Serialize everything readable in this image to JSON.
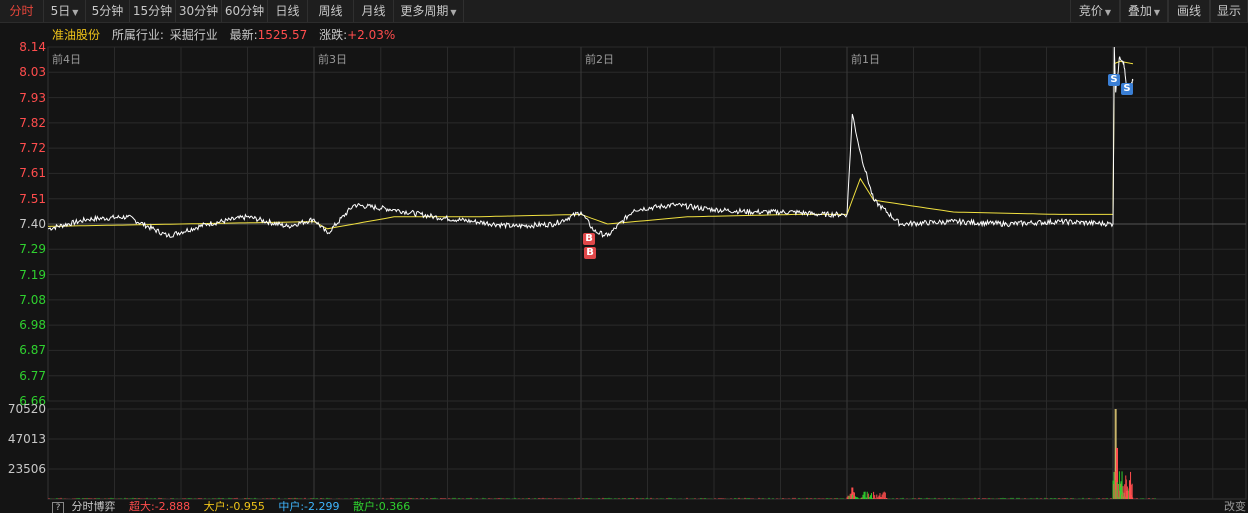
{
  "toolbar": {
    "left": [
      {
        "label": "分时",
        "active": true
      },
      {
        "label": "5日",
        "caret": true
      },
      {
        "label": "5分钟"
      },
      {
        "label": "15分钟"
      },
      {
        "label": "30分钟"
      },
      {
        "label": "60分钟"
      },
      {
        "label": "日线"
      },
      {
        "label": "周线"
      },
      {
        "label": "月线"
      },
      {
        "label": "更多周期",
        "caret": true
      }
    ],
    "right": [
      {
        "label": "竞价",
        "caret": true
      },
      {
        "label": "叠加",
        "caret": true
      },
      {
        "label": "画线"
      },
      {
        "label": "显示"
      }
    ]
  },
  "info": {
    "stock_name": "准油股份",
    "industry_label": "所属行业:",
    "industry_value": "采掘行业",
    "latest_label": "最新:",
    "latest_value": "1525.57",
    "change_label": "涨跌:",
    "change_value": "+2.03%"
  },
  "colors": {
    "up": "#ff4d4d",
    "down": "#2fd12f",
    "price_line": "#ffffff",
    "avg_line": "#f0e040",
    "grid": "#2a2a2a"
  },
  "chart_data": {
    "type": "line",
    "price_axis": {
      "ticks": [
        "8.14",
        "8.03",
        "7.93",
        "7.82",
        "7.72",
        "7.61",
        "7.51",
        "7.40",
        "7.29",
        "7.19",
        "7.08",
        "6.98",
        "6.87",
        "6.77",
        "6.66"
      ],
      "baseline": "7.40",
      "ylim": [
        6.66,
        8.14
      ]
    },
    "volume_axis": {
      "ticks": [
        "70520",
        "47013",
        "23506"
      ],
      "ylim": [
        0,
        70520
      ]
    },
    "day_labels": [
      "前4日",
      "前3日",
      "前2日",
      "前1日"
    ],
    "series": [
      {
        "key": "price",
        "description_points": "x = day index (0-5), y = price",
        "x": [
          0.0,
          0.15,
          0.3,
          0.45,
          0.6,
          0.75,
          0.9,
          1.0,
          1.05,
          1.15,
          1.3,
          1.45,
          1.6,
          1.75,
          1.9,
          2.0,
          2.05,
          2.1,
          2.2,
          2.35,
          2.5,
          2.65,
          2.8,
          2.9,
          3.0,
          3.02,
          3.05,
          3.1,
          3.2,
          3.4,
          3.6,
          3.8,
          4.0,
          4.01,
          4.02,
          4.05,
          4.08,
          4.1,
          4.12,
          4.15
        ],
        "y": [
          7.38,
          7.42,
          7.43,
          7.35,
          7.4,
          7.43,
          7.39,
          7.42,
          7.36,
          7.48,
          7.46,
          7.43,
          7.41,
          7.39,
          7.4,
          7.45,
          7.37,
          7.35,
          7.46,
          7.48,
          7.46,
          7.45,
          7.45,
          7.44,
          7.44,
          7.86,
          7.7,
          7.5,
          7.4,
          7.41,
          7.4,
          7.41,
          7.4,
          8.14,
          7.95,
          8.1,
          8.08,
          7.98,
          7.96,
          8.0
        ]
      },
      {
        "key": "avg",
        "description_points": "x = day index, y = average price",
        "x": [
          0.0,
          0.5,
          1.0,
          1.05,
          1.3,
          1.6,
          2.0,
          2.1,
          2.4,
          2.8,
          3.0,
          3.05,
          3.1,
          3.4,
          3.8,
          4.0,
          4.01,
          4.05,
          4.15
        ],
        "y": [
          7.39,
          7.4,
          7.41,
          7.38,
          7.43,
          7.43,
          7.44,
          7.4,
          7.43,
          7.44,
          7.44,
          7.59,
          7.5,
          7.45,
          7.44,
          7.44,
          8.07,
          8.08,
          8.07
        ]
      }
    ],
    "markers": [
      {
        "label": "B",
        "type": "buy"
      },
      {
        "label": "B",
        "type": "buy"
      },
      {
        "label": "S",
        "type": "sell"
      },
      {
        "label": "S",
        "type": "sell"
      }
    ],
    "volume_peaks": [
      {
        "x": 3.02,
        "value": 9000
      },
      {
        "x": 4.02,
        "value": 70520
      },
      {
        "x": 4.03,
        "value": 40000
      },
      {
        "x": 4.06,
        "value": 12000
      }
    ]
  },
  "bottom": {
    "help": "?",
    "title": "分时博弈",
    "super_label": "超大:-2.888",
    "big_label": "大户:-0.955",
    "mid_label": "中户:-2.299",
    "small_label": "散户:0.366",
    "right_label": "改变"
  }
}
